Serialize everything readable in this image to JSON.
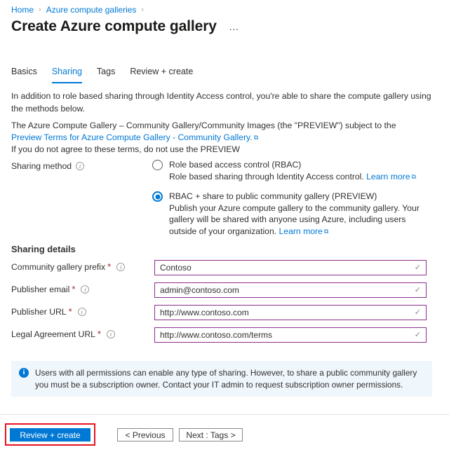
{
  "breadcrumb": {
    "items": [
      {
        "label": "Home"
      },
      {
        "label": "Azure compute galleries"
      }
    ],
    "separator": "›"
  },
  "header": {
    "title": "Create Azure compute gallery",
    "more_menu": "…"
  },
  "tabs": [
    {
      "label": "Basics",
      "active": false
    },
    {
      "label": "Sharing",
      "active": true
    },
    {
      "label": "Tags",
      "active": false
    },
    {
      "label": "Review + create",
      "active": false
    }
  ],
  "intro": {
    "text": "In addition to role based sharing through Identity Access control, you're able to share the compute gallery using the methods below."
  },
  "preview_notice": {
    "line1": "The Azure Compute Gallery – Community Gallery/Community Images (the \"PREVIEW\") subject to the",
    "link_text": "Preview Terms for Azure Compute Gallery - Community Gallery.",
    "link_glyph": "⧉",
    "line3": "If you do not agree to these terms, do not use the PREVIEW"
  },
  "sharing_method": {
    "label": "Sharing method",
    "info_icon": "info-icon",
    "options": [
      {
        "title": "Role based access control (RBAC)",
        "description": "Role based sharing through Identity Access control.",
        "learn_more": "Learn more",
        "link_glyph": "⧉",
        "selected": false
      },
      {
        "title": "RBAC + share to public community gallery (PREVIEW)",
        "description": "Publish your Azure compute gallery to the community gallery. Your gallery will be shared with anyone using Azure, including users outside of your organization.",
        "learn_more": "Learn more",
        "link_glyph": "⧉",
        "selected": true
      }
    ]
  },
  "sharing_details": {
    "heading": "Sharing details",
    "required_marker": "*",
    "validation_glyph": "✓",
    "fields": [
      {
        "label": "Community gallery prefix",
        "value": "Contoso",
        "required": true,
        "valid": true
      },
      {
        "label": "Publisher email",
        "value": "admin@contoso.com",
        "required": true,
        "valid": true
      },
      {
        "label": "Publisher URL",
        "value": "http://www.contoso.com",
        "required": true,
        "valid": true
      },
      {
        "label": "Legal Agreement URL",
        "value": "http://www.contoso.com/terms",
        "required": true,
        "valid": true
      }
    ]
  },
  "banner": {
    "icon": "info-filled-icon",
    "text": "Users with all permissions can enable any type of sharing. However, to share a public community gallery you must be a subscription owner. Contact your IT admin to request subscription owner permissions."
  },
  "footer": {
    "review_create": "Review + create",
    "previous": "< Previous",
    "next": "Next : Tags >"
  },
  "colors": {
    "accent": "#0078d4",
    "field_border": "#8c2f8e",
    "required": "#a4262c",
    "banner_bg": "#eff6fc",
    "highlight": "#e81123"
  }
}
